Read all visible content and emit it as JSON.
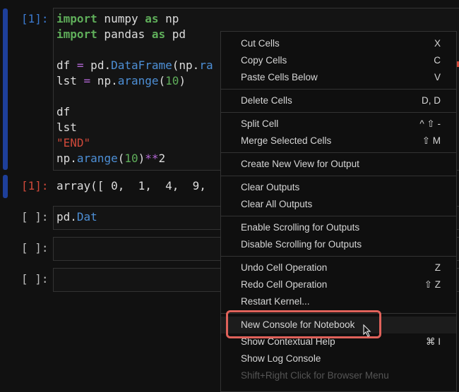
{
  "cells": [
    {
      "prompt": "[1]:",
      "lines": [
        [
          {
            "t": "import",
            "c": "kw"
          },
          {
            "t": " numpy "
          },
          {
            "t": "as",
            "c": "kw"
          },
          {
            "t": " np"
          }
        ],
        [
          {
            "t": "import",
            "c": "kw"
          },
          {
            "t": " pandas "
          },
          {
            "t": "as",
            "c": "kw"
          },
          {
            "t": " pd"
          }
        ],
        [],
        [
          {
            "t": "df "
          },
          {
            "t": "=",
            "c": "op"
          },
          {
            "t": " pd."
          },
          {
            "t": "DataFrame",
            "c": "fn"
          },
          {
            "t": "(np."
          },
          {
            "t": "ra",
            "c": "fn"
          }
        ],
        [
          {
            "t": "lst "
          },
          {
            "t": "=",
            "c": "op"
          },
          {
            "t": " np."
          },
          {
            "t": "arange",
            "c": "fn"
          },
          {
            "t": "("
          },
          {
            "t": "10",
            "c": "num"
          },
          {
            "t": ")"
          }
        ],
        [],
        [
          {
            "t": "df"
          }
        ],
        [
          {
            "t": "lst"
          }
        ],
        [
          {
            "t": "\"END\"",
            "c": "str"
          }
        ],
        [
          {
            "t": "np."
          },
          {
            "t": "arange",
            "c": "fn"
          },
          {
            "t": "("
          },
          {
            "t": "10",
            "c": "num"
          },
          {
            "t": ")"
          },
          {
            "t": "**",
            "c": "op"
          },
          {
            "t": "2"
          }
        ]
      ]
    },
    {
      "prompt": "[1]:",
      "output": "array([ 0,  1,  4,  9,"
    },
    {
      "prompt": "[ ]:",
      "lines": [
        [
          {
            "t": "pd."
          },
          {
            "t": "Dat",
            "c": "fn"
          }
        ]
      ]
    },
    {
      "prompt": "[ ]:"
    },
    {
      "prompt": "[ ]:"
    }
  ],
  "menu": {
    "groups": [
      [
        {
          "label": "Cut Cells",
          "shortcut": "X"
        },
        {
          "label": "Copy Cells",
          "shortcut": "C"
        },
        {
          "label": "Paste Cells Below",
          "shortcut": "V"
        }
      ],
      [
        {
          "label": "Delete Cells",
          "shortcut": "D, D"
        }
      ],
      [
        {
          "label": "Split Cell",
          "shortcut": "^ ⇧ -"
        },
        {
          "label": "Merge Selected Cells",
          "shortcut": "⇧ M"
        }
      ],
      [
        {
          "label": "Create New View for Output"
        }
      ],
      [
        {
          "label": "Clear Outputs"
        },
        {
          "label": "Clear All Outputs"
        }
      ],
      [
        {
          "label": "Enable Scrolling for Outputs"
        },
        {
          "label": "Disable Scrolling for Outputs"
        }
      ],
      [
        {
          "label": "Undo Cell Operation",
          "shortcut": "Z"
        },
        {
          "label": "Redo Cell Operation",
          "shortcut": "⇧ Z"
        },
        {
          "label": "Restart Kernel..."
        }
      ],
      [
        {
          "label": "New Console for Notebook",
          "hovered": true
        },
        {
          "label": "Show Contextual Help",
          "shortcut": "⌘ I"
        },
        {
          "label": "Show Log Console"
        },
        {
          "label": "Shift+Right Click for Browser Menu",
          "disabled": true
        }
      ]
    ]
  },
  "highlight_color": "#e0625a"
}
